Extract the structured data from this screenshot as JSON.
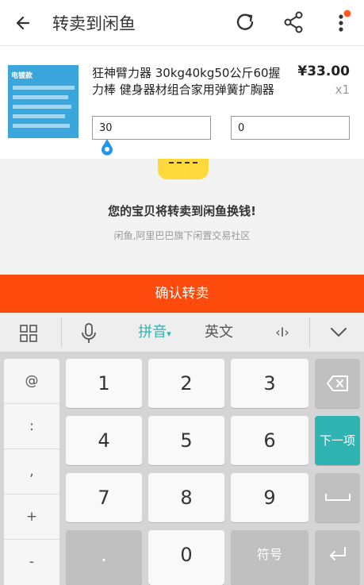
{
  "header": {
    "title": "转卖到闲鱼"
  },
  "product": {
    "name": "狂神臂力器 30kg40kg50公斤60握力棒 健身器材组合家用弹簧扩胸器",
    "price": "¥33.00",
    "quantity": "x1",
    "thumb_label": "电镀款",
    "field_a_value": "30",
    "field_b_value": "0"
  },
  "promo": {
    "headline": "您的宝贝将转卖到闲鱼换钱!",
    "subline": "闲鱼,阿里巴巴旗下闲置交易社区"
  },
  "confirm_label": "确认转卖",
  "keyboard_bar": {
    "pinyin": "拼音",
    "english": "英文",
    "cursor": "‹I›"
  },
  "keyboard": {
    "symbols": [
      "@",
      ":",
      ",",
      "+",
      "-"
    ],
    "digits": [
      "1",
      "2",
      "3",
      "4",
      "5",
      "6",
      "7",
      "8",
      "9",
      ".",
      "0"
    ],
    "next_label": "下一项",
    "symbol_key": "符号"
  },
  "colors": {
    "accent": "#ff4a0d",
    "next_key": "#2fb3b3",
    "notification_dot": "#ff5a1f"
  }
}
